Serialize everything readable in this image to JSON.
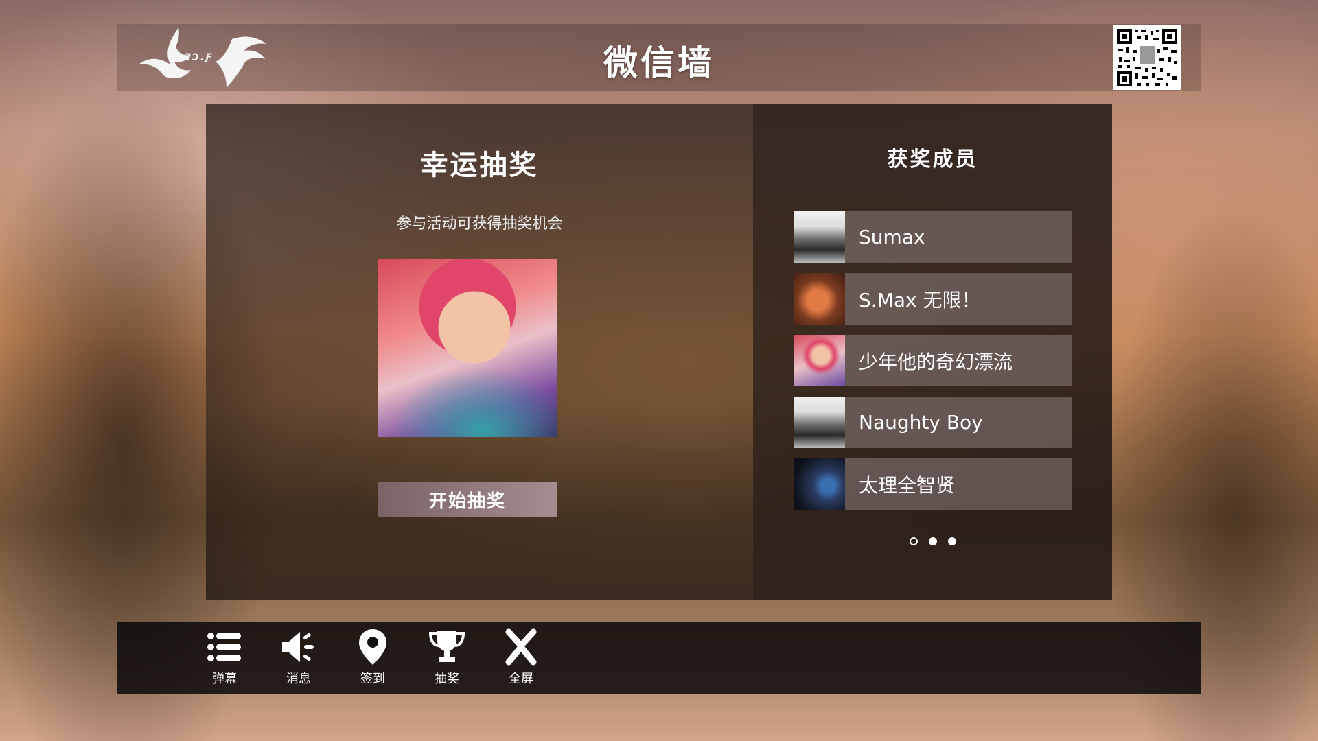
{
  "header": {
    "logo_text": "ƎƆ.Ƒ",
    "title": "微信墙"
  },
  "lottery": {
    "title": "幸运抽奖",
    "subtitle": "参与活动可获得抽奖机会",
    "start_button": "开始抽奖"
  },
  "winners": {
    "title": "获奖成员",
    "items": [
      {
        "name": "Sumax"
      },
      {
        "name": "S.Max 无限！"
      },
      {
        "name": "少年他的奇幻漂流"
      },
      {
        "name": "Naughty Boy"
      },
      {
        "name": "太理全智贤"
      }
    ],
    "pager": {
      "total": 3,
      "current": 1
    }
  },
  "toolbar": {
    "items": [
      {
        "label": "弹幕",
        "icon": "list-icon"
      },
      {
        "label": "消息",
        "icon": "speaker-icon"
      },
      {
        "label": "签到",
        "icon": "location-pin-icon"
      },
      {
        "label": "抽奖",
        "icon": "trophy-icon"
      },
      {
        "label": "全屏",
        "icon": "close-x-icon"
      }
    ]
  }
}
